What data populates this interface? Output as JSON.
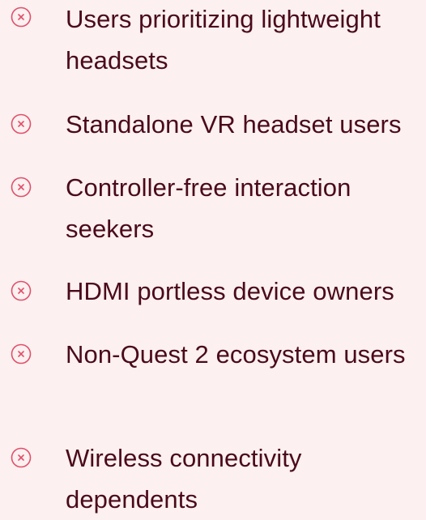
{
  "colors": {
    "background": "#fdf0f0",
    "text": "#4a0a1a",
    "icon": "#e0506a"
  },
  "icon_name": "close-circle-icon",
  "items": [
    {
      "label": "Users prioritizing lightweight headsets"
    },
    {
      "label": "Standalone VR headset users"
    },
    {
      "label": "Controller-free interaction seekers"
    },
    {
      "label": "HDMI portless device owners"
    },
    {
      "label": "Non-Quest 2 ecosystem users"
    },
    {
      "label": "Wireless connectivity dependents"
    }
  ]
}
